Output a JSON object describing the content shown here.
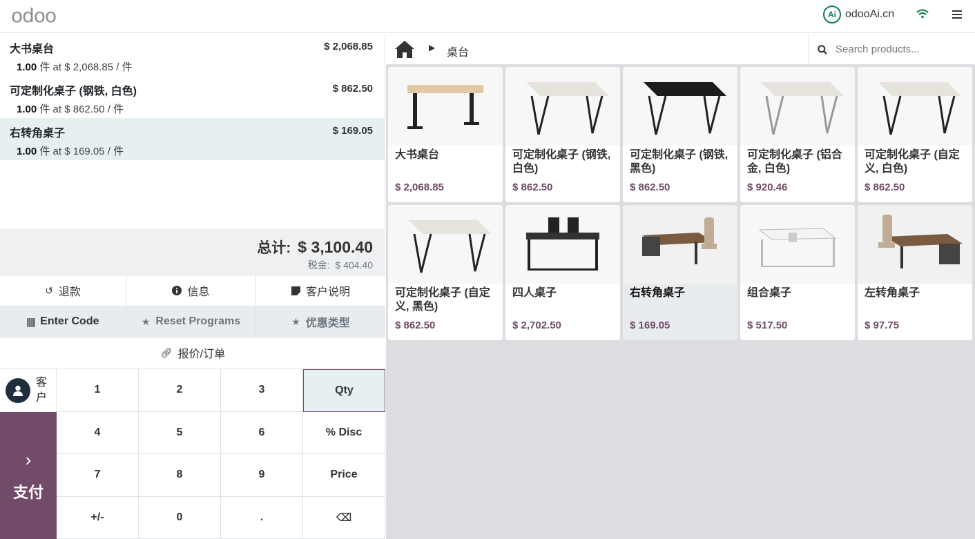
{
  "header": {
    "logo": "odoo",
    "brand_name": "odooAi.cn",
    "brand_mark": "Ai",
    "icons": [
      "wifi-icon",
      "hamburger-menu-icon"
    ]
  },
  "order": {
    "lines": [
      {
        "name": "大书桌台",
        "price": "$ 2,068.85",
        "qty": "1.00",
        "info": " 件 at $ 2,068.85 / 件"
      },
      {
        "name": "可定制化桌子 (钢铁, 白色)",
        "price": "$ 862.50",
        "qty": "1.00",
        "info": " 件 at $ 862.50 / 件"
      },
      {
        "name": "右转角桌子",
        "price": "$ 169.05",
        "qty": "1.00",
        "info": " 件 at $ 169.05 / 件"
      }
    ],
    "total_label": "总计:",
    "total": "$ 3,100.40",
    "tax_label": "税金:",
    "tax": "$ 404.40"
  },
  "controls": {
    "refund": "退款",
    "info": "信息",
    "customer_note": "客户说明",
    "enter_code": "Enter Code",
    "reset_programs": "Reset Programs",
    "discount_type": "优惠类型",
    "quotation": "报价/订单"
  },
  "numpad": {
    "customer": "客户",
    "pay": "支付",
    "keys": [
      "1",
      "2",
      "3",
      "Qty",
      "4",
      "5",
      "6",
      "% Disc",
      "7",
      "8",
      "9",
      "Price",
      "+/-",
      "0",
      ".",
      "⌫"
    ]
  },
  "products_bar": {
    "breadcrumb": "桌台",
    "search_placeholder": "Search products..."
  },
  "products": [
    {
      "name": "大书桌台",
      "price": "$ 2,068.85"
    },
    {
      "name": "可定制化桌子 (钢铁, 白色)",
      "price": "$ 862.50"
    },
    {
      "name": "可定制化桌子 (钢铁, 黑色)",
      "price": "$ 862.50"
    },
    {
      "name": "可定制化桌子 (铝合金, 白色)",
      "price": "$ 920.46"
    },
    {
      "name": "可定制化桌子 (自定义, 白色)",
      "price": "$ 862.50"
    },
    {
      "name": "可定制化桌子 (自定义, 黑色)",
      "price": "$ 862.50"
    },
    {
      "name": "四人桌子",
      "price": "$ 2,702.50"
    },
    {
      "name": "右转角桌子",
      "price": "$ 169.05"
    },
    {
      "name": "组合桌子",
      "price": "$ 517.50"
    },
    {
      "name": "左转角桌子",
      "price": "$ 97.75"
    }
  ],
  "colors": {
    "accent": "#714B67",
    "selected_bg": "#e6f0f2",
    "brand_green": "#0d7a5f"
  }
}
